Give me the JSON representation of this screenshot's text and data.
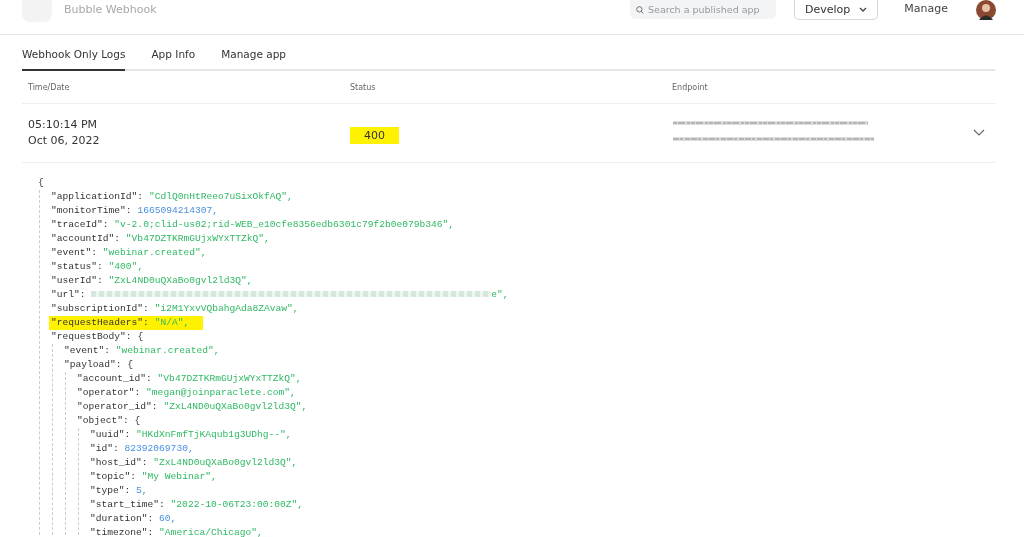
{
  "header": {
    "app_name": "Bubble Webhook",
    "search": {
      "placeholder": "Search a published app"
    },
    "develop_button": "Develop",
    "manage_link": "Manage"
  },
  "tabs": [
    {
      "label": "Webhook Only Logs",
      "selected": true
    },
    {
      "label": "App Info",
      "selected": false
    },
    {
      "label": "Manage app",
      "selected": false
    }
  ],
  "table": {
    "columns": [
      "Time/Date",
      "Status",
      "Endpoint"
    ],
    "rows": [
      {
        "time": "05:10:14 PM",
        "date": "Oct 06, 2022",
        "status": "400",
        "status_highlighted": true,
        "endpoint_redacted": true,
        "expanded": false
      }
    ]
  },
  "log": {
    "open": "{",
    "entries": [
      {
        "key": "\"applicationId\":",
        "value": "\"CdlQ0nHtReeo7uSixOkfAQ\",",
        "kind": "string",
        "highlighted": false
      },
      {
        "key": "\"monitorTime\":",
        "value": "1665094214307,",
        "kind": "number",
        "highlighted": false
      },
      {
        "key": "\"traceId\":",
        "value": "\"v-2.0;clid-us02;rid-WEB_e10cfe8356edb6301c79f2b0e079b346\",",
        "kind": "string",
        "highlighted": false
      },
      {
        "key": "\"accountId\":",
        "value": "\"Vb47DZTKRmGUjxWYxTTZkQ\",",
        "kind": "string",
        "highlighted": false
      },
      {
        "key": "\"event\":",
        "value": "\"webinar.created\",",
        "kind": "string",
        "highlighted": false
      },
      {
        "key": "\"status\":",
        "value": "\"400\",",
        "kind": "string",
        "highlighted": false
      },
      {
        "key": "\"userId\":",
        "value": "\"ZxL4ND0uQXaBo0gvl2ld3Q\",",
        "kind": "string",
        "highlighted": false
      },
      {
        "key": "\"url\":",
        "value": "e\",",
        "kind": "redacted",
        "highlighted": false
      },
      {
        "key": "\"subscriptionId\":",
        "value": "\"i2M1YxvVQbahgAda8ZAvaw\",",
        "kind": "string",
        "highlighted": false
      },
      {
        "key": "\"requestHeaders\":",
        "value": "\"N/A\",",
        "kind": "string",
        "highlighted": true
      },
      {
        "key": "\"requestBody\":",
        "value": "{",
        "kind": "object",
        "highlighted": false,
        "children": [
          {
            "key": "\"event\":",
            "value": "\"webinar.created\",",
            "kind": "string",
            "highlighted": false
          },
          {
            "key": "\"payload\":",
            "value": "{",
            "kind": "object",
            "highlighted": false,
            "children": [
              {
                "key": "\"account_id\":",
                "value": "\"Vb47DZTKRmGUjxWYxTTZkQ\",",
                "kind": "string",
                "highlighted": false
              },
              {
                "key": "\"operator\":",
                "value": "\"megan@joinparaclete.com\",",
                "kind": "string",
                "highlighted": false
              },
              {
                "key": "\"operator_id\":",
                "value": "\"ZxL4ND0uQXaBo0gvl2ld3Q\",",
                "kind": "string",
                "highlighted": false
              },
              {
                "key": "\"object\":",
                "value": "{",
                "kind": "object",
                "highlighted": false,
                "children": [
                  {
                    "key": "\"uuid\":",
                    "value": "\"HKdXnFmfTjKAqub1g3UDhg--\",",
                    "kind": "string",
                    "highlighted": false
                  },
                  {
                    "key": "\"id\":",
                    "value": "82392069730,",
                    "kind": "number",
                    "highlighted": false
                  },
                  {
                    "key": "\"host_id\":",
                    "value": "\"ZxL4ND0uQXaBo0gvl2ld3Q\",",
                    "kind": "string",
                    "highlighted": false
                  },
                  {
                    "key": "\"topic\":",
                    "value": "\"My Webinar\",",
                    "kind": "string",
                    "highlighted": false
                  },
                  {
                    "key": "\"type\":",
                    "value": "5,",
                    "kind": "number",
                    "highlighted": false
                  },
                  {
                    "key": "\"start_time\":",
                    "value": "\"2022-10-06T23:00:00Z\",",
                    "kind": "string",
                    "highlighted": false
                  },
                  {
                    "key": "\"duration\":",
                    "value": "60,",
                    "kind": "number",
                    "highlighted": false
                  },
                  {
                    "key": "\"timezone\":",
                    "value": "\"America/Chicago\",",
                    "kind": "string",
                    "highlighted": false
                  }
                ]
              }
            ]
          }
        ]
      }
    ]
  }
}
